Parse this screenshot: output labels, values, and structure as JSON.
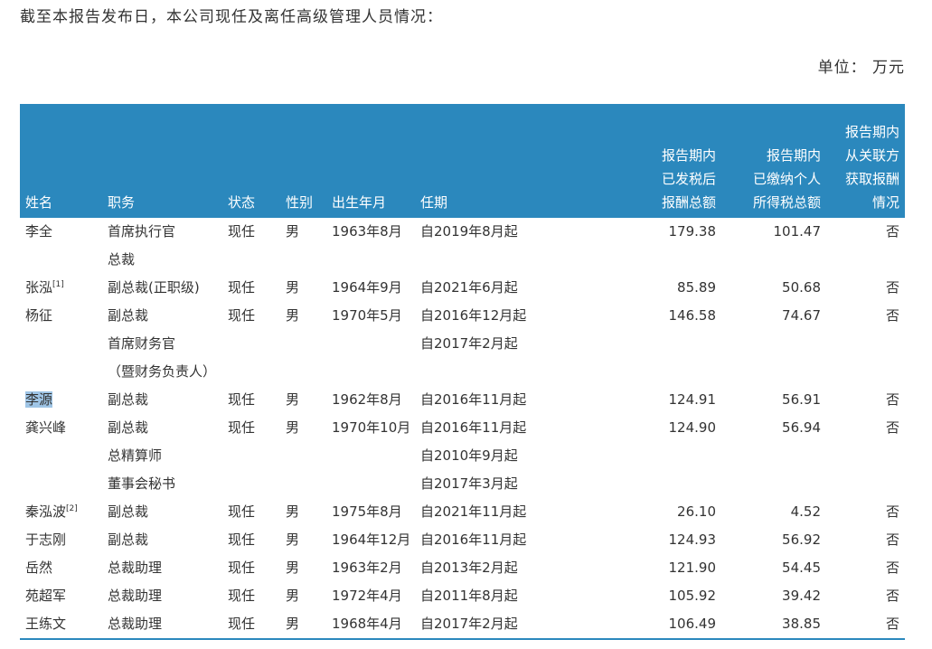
{
  "intro": "截至本报告发布日，本公司现任及离任高级管理人员情况：",
  "unit": "单位：  万元",
  "headers": {
    "name": "姓名",
    "position": "职务",
    "status": "状态",
    "gender": "性别",
    "birth": "出生年月",
    "term": "任期",
    "pay": [
      "报告期内",
      "已发税后",
      "报酬总额"
    ],
    "tax": [
      "报告期内",
      "已缴纳个人",
      "所得税总额"
    ],
    "related": [
      "报告期内",
      "从关联方",
      "获取报酬",
      "情况"
    ]
  },
  "rows": [
    {
      "name": "李全",
      "note": "",
      "positions": [
        "首席执行官",
        "总裁"
      ],
      "status": "现任",
      "gender": "男",
      "birth": "1963年8月",
      "terms": [
        "自2019年8月起"
      ],
      "pay": "179.38",
      "tax": "101.47",
      "related": "否"
    },
    {
      "name": "张泓",
      "note": "[1]",
      "positions": [
        "副总裁(正职级)"
      ],
      "status": "现任",
      "gender": "男",
      "birth": "1964年9月",
      "terms": [
        "自2021年6月起"
      ],
      "pay": "85.89",
      "tax": "50.68",
      "related": "否"
    },
    {
      "name": "杨征",
      "note": "",
      "positions": [
        "副总裁",
        "首席财务官",
        "（暨财务负责人）"
      ],
      "status": "现任",
      "gender": "男",
      "birth": "1970年5月",
      "terms": [
        "自2016年12月起",
        "自2017年2月起"
      ],
      "pay": "146.58",
      "tax": "74.67",
      "related": "否"
    },
    {
      "name": "李源",
      "note": "",
      "positions": [
        "副总裁"
      ],
      "status": "现任",
      "gender": "男",
      "birth": "1962年8月",
      "terms": [
        "自2016年11月起"
      ],
      "pay": "124.91",
      "tax": "56.91",
      "related": "否"
    },
    {
      "name": "龚兴峰",
      "note": "",
      "positions": [
        "副总裁",
        "总精算师",
        "董事会秘书"
      ],
      "status": "现任",
      "gender": "男",
      "birth": "1970年10月",
      "terms": [
        "自2016年11月起",
        "自2010年9月起",
        "自2017年3月起"
      ],
      "pay": "124.90",
      "tax": "56.94",
      "related": "否"
    },
    {
      "name": "秦泓波",
      "note": "[2]",
      "positions": [
        "副总裁"
      ],
      "status": "现任",
      "gender": "男",
      "birth": "1975年8月",
      "terms": [
        "自2021年11月起"
      ],
      "pay": "26.10",
      "tax": "4.52",
      "related": "否"
    },
    {
      "name": "于志刚",
      "note": "",
      "positions": [
        "副总裁"
      ],
      "status": "现任",
      "gender": "男",
      "birth": "1964年12月",
      "terms": [
        "自2016年11月起"
      ],
      "pay": "124.93",
      "tax": "56.92",
      "related": "否"
    },
    {
      "name": "岳然",
      "note": "",
      "positions": [
        "总裁助理"
      ],
      "status": "现任",
      "gender": "男",
      "birth": "1963年2月",
      "terms": [
        "自2013年2月起"
      ],
      "pay": "121.90",
      "tax": "54.45",
      "related": "否"
    },
    {
      "name": "苑超军",
      "note": "",
      "positions": [
        "总裁助理"
      ],
      "status": "现任",
      "gender": "男",
      "birth": "1972年4月",
      "terms": [
        "自2011年8月起"
      ],
      "pay": "105.92",
      "tax": "39.42",
      "related": "否"
    },
    {
      "name": "王练文",
      "note": "",
      "positions": [
        "总裁助理"
      ],
      "status": "现任",
      "gender": "男",
      "birth": "1968年4月",
      "terms": [
        "自2017年2月起"
      ],
      "pay": "106.49",
      "tax": "38.85",
      "related": "否"
    }
  ]
}
